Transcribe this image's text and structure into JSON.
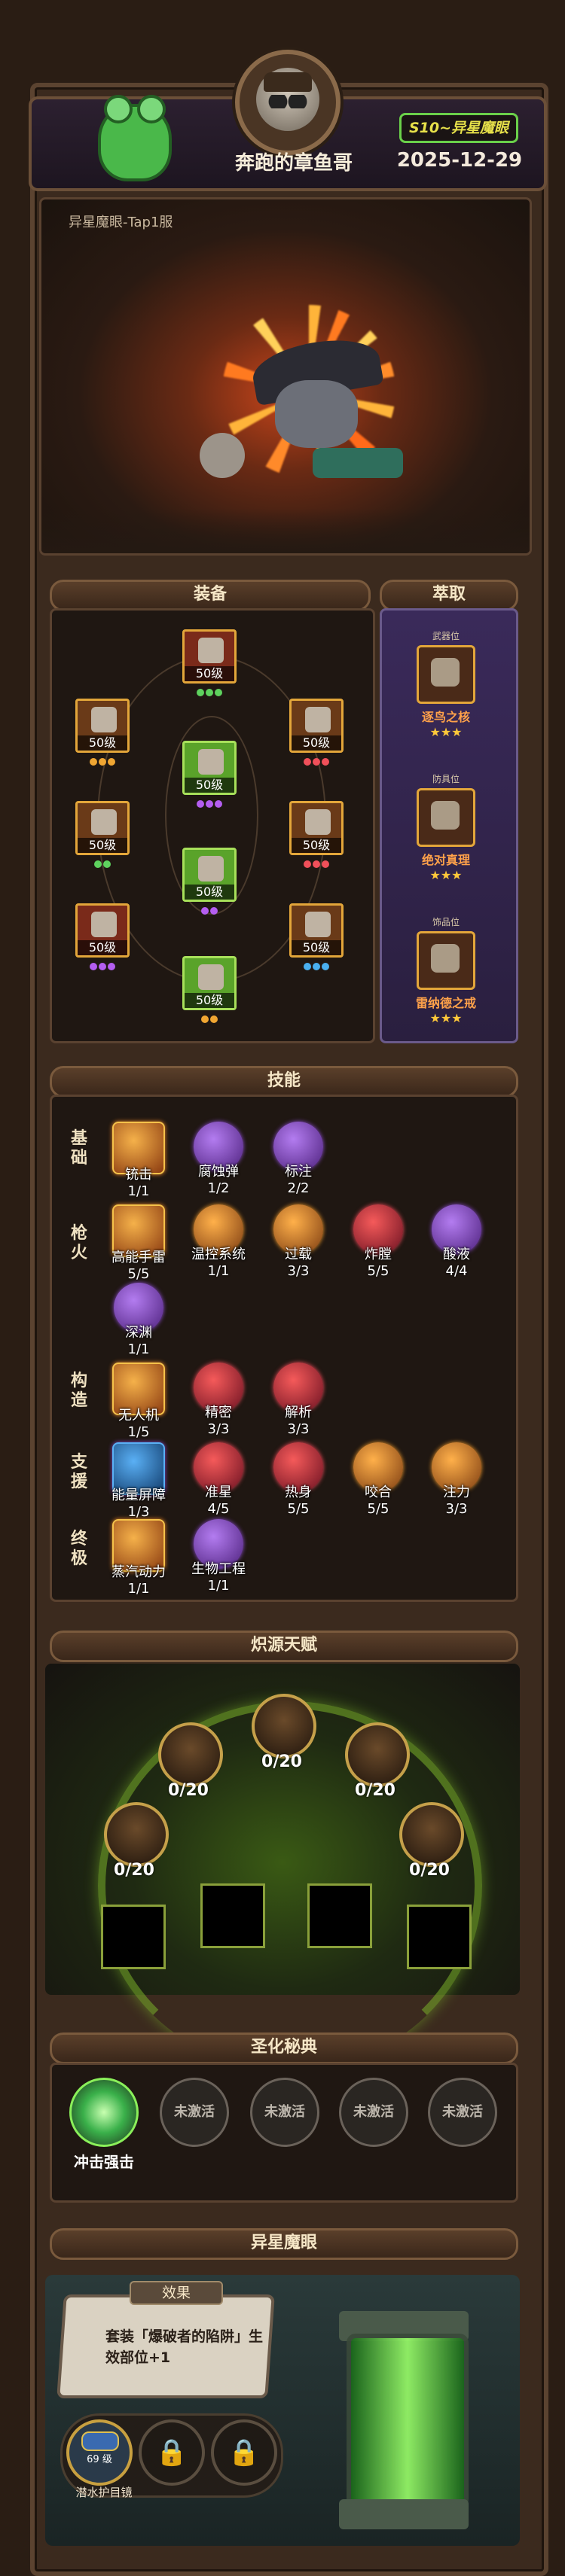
{
  "header": {
    "player_name": "奔跑的章鱼哥",
    "season_badge": "S10~异星魔眼",
    "date": "2025-12-29"
  },
  "hero": {
    "label": "异星魔眼-Tap1服"
  },
  "sections": {
    "equipment": "装备",
    "extract": "萃取",
    "skills": "技能",
    "talent": "炽源天赋",
    "holy": "圣化秘典",
    "alien_eye": "异星魔眼"
  },
  "equipment": {
    "slots": [
      {
        "level": "50级",
        "color": "red",
        "dots": [
          "or",
          "or",
          "or"
        ]
      },
      {
        "level": "50级",
        "color": "or",
        "dots": [
          "or",
          "or",
          "or"
        ]
      },
      {
        "level": "50级",
        "color": "or",
        "dots": [
          "re",
          "re",
          "re"
        ]
      },
      {
        "level": "50级",
        "color": "green",
        "dots": [
          "pu",
          "pu",
          "pu"
        ]
      },
      {
        "level": "50级",
        "color": "or",
        "dots": [
          "gr",
          "gr"
        ]
      },
      {
        "level": "50级",
        "color": "or",
        "dots": [
          "re",
          "re",
          "re"
        ]
      },
      {
        "level": "50级",
        "color": "green",
        "dots": [
          "pu",
          "pu"
        ]
      },
      {
        "level": "50级",
        "color": "red",
        "dots": [
          "pu",
          "pu",
          "pu"
        ]
      },
      {
        "level": "50级",
        "color": "or",
        "dots": [
          "bl",
          "bl",
          "bl"
        ]
      },
      {
        "level": "50级",
        "color": "green",
        "dots": [
          "or",
          "or"
        ]
      },
      {
        "level": "50级",
        "color": "green",
        "dots": [
          "gr",
          "gr",
          "gr"
        ]
      }
    ]
  },
  "extract": {
    "items": [
      {
        "tag": "武器位",
        "name": "逐鸟之核",
        "stars": "★★★"
      },
      {
        "tag": "防具位",
        "name": "绝对真理",
        "stars": "★★★"
      },
      {
        "tag": "饰品位",
        "name": "雷纳德之戒",
        "stars": "★★★"
      }
    ]
  },
  "skills": {
    "rows": [
      {
        "label": "基础",
        "items": [
          {
            "name": "铳击",
            "count": "1/1"
          },
          {
            "name": "腐蚀弹",
            "count": "1/2"
          },
          {
            "name": "标注",
            "count": "2/2"
          }
        ]
      },
      {
        "label": "枪火",
        "items": [
          {
            "name": "高能手雷",
            "count": "5/5"
          },
          {
            "name": "温控系统",
            "count": "1/1"
          },
          {
            "name": "过载",
            "count": "3/3"
          },
          {
            "name": "炸膛",
            "count": "5/5"
          },
          {
            "name": "酸液",
            "count": "4/4"
          },
          {
            "name": "深渊",
            "count": "1/1"
          }
        ]
      },
      {
        "label": "构造",
        "items": [
          {
            "name": "无人机",
            "count": "1/5"
          },
          {
            "name": "精密",
            "count": "3/3"
          },
          {
            "name": "解析",
            "count": "3/3"
          }
        ]
      },
      {
        "label": "支援",
        "items": [
          {
            "name": "能量屏障",
            "count": "1/3"
          },
          {
            "name": "准星",
            "count": "4/5"
          },
          {
            "name": "热身",
            "count": "5/5"
          },
          {
            "name": "咬合",
            "count": "5/5"
          },
          {
            "name": "注力",
            "count": "3/3"
          }
        ]
      },
      {
        "label": "终极",
        "items": [
          {
            "name": "蒸汽动力",
            "count": "1/1"
          },
          {
            "name": "生物工程",
            "count": "1/1"
          }
        ]
      }
    ]
  },
  "talent": {
    "nodes": [
      {
        "value": "0/20"
      },
      {
        "value": "0/20"
      },
      {
        "value": "0/20"
      },
      {
        "value": "0/20"
      },
      {
        "value": "0/20"
      }
    ]
  },
  "holy": {
    "nodes": [
      {
        "label": "冲击强击",
        "state": "active"
      },
      {
        "label": "未激活",
        "state": "inactive"
      },
      {
        "label": "未激活",
        "state": "inactive"
      },
      {
        "label": "未激活",
        "state": "inactive"
      },
      {
        "label": "未激活",
        "state": "inactive"
      }
    ]
  },
  "alien_eye": {
    "effect_title": "效果",
    "effect_text": "套装「爆破者的陷阱」生效部位+1",
    "goggles_level": "69 级",
    "goggles_name": "潜水护目镜"
  }
}
